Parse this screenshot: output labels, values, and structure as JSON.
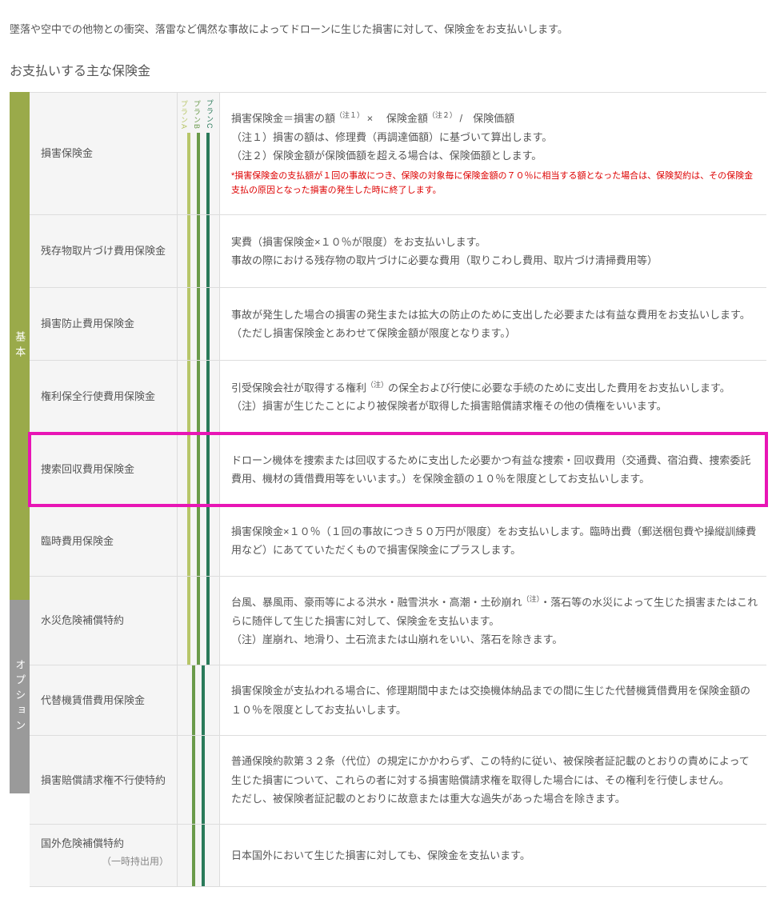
{
  "intro": "墜落や空中での他物との衝突、落雷など偶然な事故によってドローンに生じた損害に対して、保険金をお支払いします。",
  "section_title": "お支払いする主な保険金",
  "categories": {
    "basic": "基本",
    "option": "オプション"
  },
  "plan_headers": {
    "a": "プランA",
    "b": "プランB",
    "c": "プランC"
  },
  "rows": [
    {
      "label": "損害保険金",
      "desc_main": "損害保険金＝損害の額",
      "desc_sup1": "（注１）",
      "desc_mid": " × 　保険金額",
      "desc_sup2": "（注２）",
      "desc_end": " /　保険価額",
      "note1": "（注１）損害の額は、修理費（再調達価額）に基づいて算出します。",
      "note2": "（注２）保険金額が保険価額を超える場合は、保険価額とします。",
      "red": "*損害保険金の支払額が１回の事故につき、保険の対象毎に保険金額の７０％に相当する額となった場合は、保険契約は、その保険金支払の原因となった損害の発生した時に終了します。"
    },
    {
      "label": "残存物取片づけ費用保険金",
      "desc": "実費（損害保険金×１０％が限度）をお支払いします。\n事故の際における残存物の取片づけに必要な費用（取りこわし費用、取片づけ清掃費用等）"
    },
    {
      "label": "損害防止費用保険金",
      "desc": "事故が発生した場合の損害の発生または拡大の防止のために支出した必要または有益な費用をお支払いします。\n（ただし損害保険金とあわせて保険金額が限度となります。）"
    },
    {
      "label": "権利保全行使費用保険金",
      "desc_pre": "引受保険会社が取得する権利",
      "desc_sup": "（注）",
      "desc_post": "の保全および行使に必要な手続のために支出した費用をお支払いします。",
      "note": "（注）損害が生じたことにより被保険者が取得した損害賠償請求権その他の債権をいいます。"
    },
    {
      "label": "捜索回収費用保険金",
      "desc": "ドローン機体を捜索または回収するために支出した必要かつ有益な捜索・回収費用（交通費、宿泊費、捜索委託費用、機材の賃借費用等をいいます。）を保険金額の１０％を限度としてお支払いします。"
    },
    {
      "label": "臨時費用保険金",
      "desc": "損害保険金×１０％（１回の事故につき５０万円が限度）をお支払いします。臨時出費（郵送梱包費や操縦訓練費用など）にあてていただくもので損害保険金にプラスします。"
    },
    {
      "label": "水災危険補償特約",
      "desc_pre": "台風、暴風雨、豪雨等による洪水・融雪洪水・高潮・土砂崩れ",
      "desc_sup": "（注）",
      "desc_post": "・落石等の水災によって生じた損害またはこれらに随伴して生じた損害に対して、保険金を支払います。",
      "note": "（注）崖崩れ、地滑り、土石流または山崩れをいい、落石を除きます。"
    },
    {
      "label": "代替機賃借費用保険金",
      "desc": "損害保険金が支払われる場合に、修理期間中または交換機体納品までの間に生じた代替機賃借費用を保険金額の１０％を限度としてお支払いします。"
    },
    {
      "label": "損害賠償請求権不行使特約",
      "desc": "普通保険約款第３２条（代位）の規定にかかわらず、この特約に従い、被保険者証記載のとおりの責めによって生じた損害について、これらの者に対する損害賠償請求権を取得した場合には、その権利を行使しません。\nただし、被保険者証記載のとおりに故意または重大な過失があった場合を除きます。"
    },
    {
      "label": "国外危険補償特約",
      "sub_label": "（一時持出用）",
      "desc": "日本国外において生じた損害に対しても、保険金を支払います。"
    }
  ]
}
